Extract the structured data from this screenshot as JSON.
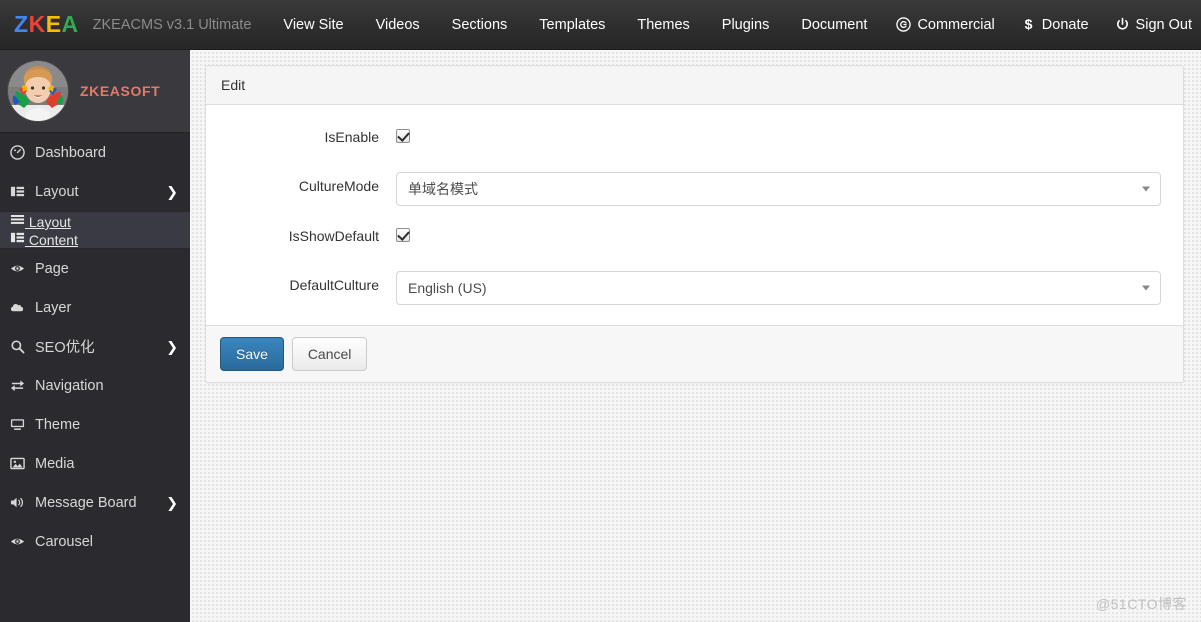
{
  "navbar": {
    "brand": {
      "l1": "Z",
      "l2": "K",
      "l3": "E",
      "l4": "A"
    },
    "title": "ZKEACMS v3.1 Ultimate",
    "links": [
      {
        "label": "View Site"
      },
      {
        "label": "Videos"
      },
      {
        "label": "Sections"
      },
      {
        "label": "Templates"
      },
      {
        "label": "Themes"
      },
      {
        "label": "Plugins"
      },
      {
        "label": "Document"
      }
    ],
    "right": [
      {
        "label": "Commercial",
        "icon": "copyright-icon"
      },
      {
        "label": "Donate",
        "icon": "dollar-icon"
      },
      {
        "label": "Sign Out",
        "icon": "power-icon"
      }
    ]
  },
  "sidebar": {
    "profile": {
      "name": "ZKEASOFT",
      "avatar": "child-with-painted-hands-avatar"
    },
    "items": [
      {
        "label": "Dashboard",
        "icon": "dashboard-icon",
        "caret": ""
      },
      {
        "label": "Layout",
        "icon": "columns-icon",
        "caret": "❯"
      },
      {
        "label": "Page",
        "icon": "eye-icon",
        "caret": ""
      },
      {
        "label": "Layer",
        "icon": "cloud-icon",
        "caret": ""
      },
      {
        "label": "SEO优化",
        "icon": "search-icon",
        "caret": "❯"
      },
      {
        "label": "Navigation",
        "icon": "exchange-icon",
        "caret": ""
      },
      {
        "label": "Theme",
        "icon": "desktop-icon",
        "caret": ""
      },
      {
        "label": "Media",
        "icon": "image-icon",
        "caret": ""
      },
      {
        "label": "Message Board",
        "icon": "volume-icon",
        "caret": "❯"
      },
      {
        "label": "Carousel",
        "icon": "eye-icon",
        "caret": ""
      }
    ],
    "submenu": [
      {
        "label": "Layout",
        "icon": "list-icon"
      },
      {
        "label": "Content",
        "icon": "columns-icon"
      }
    ]
  },
  "panel": {
    "heading": "Edit",
    "fields": [
      {
        "label": "IsEnable",
        "type": "checkbox",
        "checked": true
      },
      {
        "label": "CultureMode",
        "type": "select",
        "value": "单域名模式"
      },
      {
        "label": "IsShowDefault",
        "type": "checkbox",
        "checked": true
      },
      {
        "label": "DefaultCulture",
        "type": "select",
        "value": "English (US)"
      }
    ],
    "buttons": {
      "save": "Save",
      "cancel": "Cancel"
    }
  },
  "watermark": "@51CTO博客",
  "colors": {
    "navbar_bg": "#2e2e2e",
    "sidebar_bg": "#2b2b2f",
    "submenu_bg": "#3a3a42",
    "brand_blue": "#4285f4",
    "brand_red": "#ea4335",
    "brand_yellow": "#fbbc05",
    "brand_green": "#34a853",
    "profile_name": "#e27a6a",
    "primary_button": "#2a6a9c",
    "page_bg": "#f6f6f6"
  }
}
